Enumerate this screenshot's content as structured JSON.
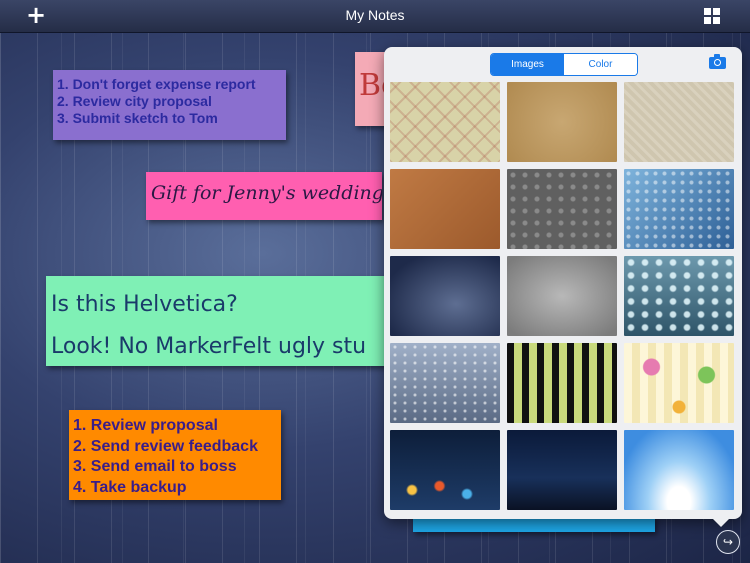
{
  "app": {
    "title": "My Notes",
    "add_glyph": "+"
  },
  "colors": {
    "accent": "#1a7ae8"
  },
  "notes": [
    {
      "lines": [
        "1. Don't forget expense report",
        "2. Review city proposal",
        "3. Submit sketch to Tom"
      ]
    },
    {
      "lines": [
        "Bo"
      ]
    },
    {
      "lines": [
        "Gift for Jenny's wedding."
      ]
    },
    {
      "lines": [
        "Is this Helvetica?",
        "Look! No MarkerFelt ugly stu"
      ]
    },
    {
      "lines": [
        "1. Review proposal",
        "2. Send review feedback",
        "3. Send email to boss",
        "4. Take backup"
      ]
    }
  ],
  "picker": {
    "tabs": [
      {
        "label": "Images",
        "selected": true
      },
      {
        "label": "Color",
        "selected": false
      }
    ],
    "icons": {
      "camera": "camera-icon",
      "share": "share-icon",
      "grid": "grid-icon"
    }
  }
}
